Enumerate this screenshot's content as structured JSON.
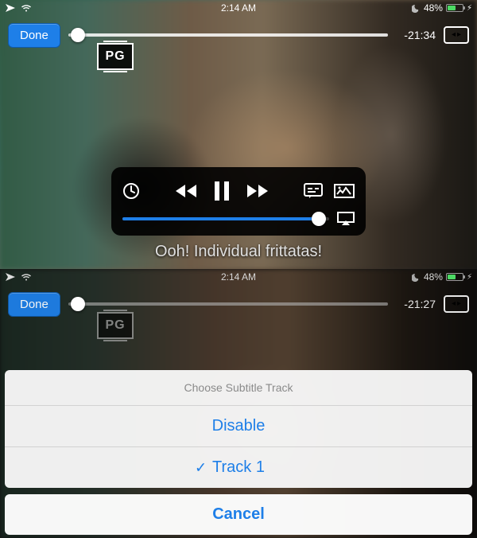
{
  "status": {
    "time": "2:14 AM",
    "battery_text": "48%",
    "battery_level": 0.48
  },
  "top_player": {
    "done_label": "Done",
    "rating": "PG",
    "time_remaining": "-21:34",
    "progress_position_pct": 3,
    "volume_pct": 95,
    "caption": "Ooh! Individual frittatas!"
  },
  "bottom_player": {
    "done_label": "Done",
    "rating": "PG",
    "time_remaining": "-21:27",
    "progress_position_pct": 3
  },
  "sheet": {
    "title": "Choose Subtitle Track",
    "options": [
      {
        "label": "Disable",
        "selected": false
      },
      {
        "label": "Track 1",
        "selected": true
      }
    ],
    "cancel_label": "Cancel"
  }
}
